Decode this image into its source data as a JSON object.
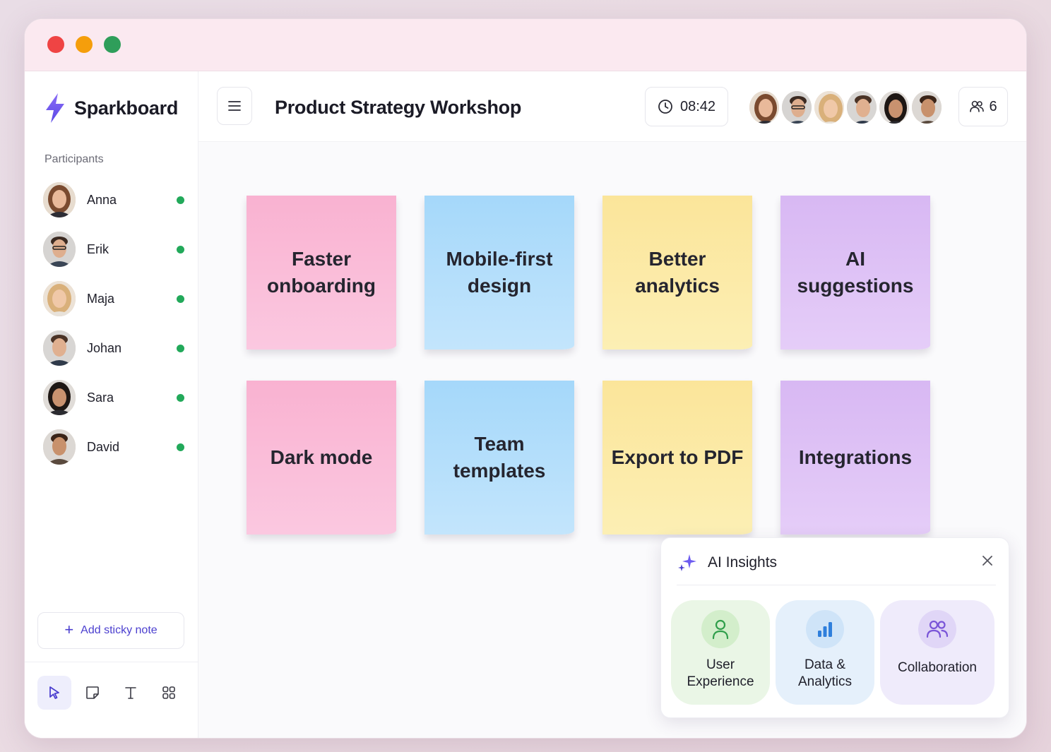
{
  "brand": {
    "name": "Sparkboard"
  },
  "sidebar": {
    "participants_label": "Participants",
    "participants": [
      {
        "name": "Anna",
        "status": "online"
      },
      {
        "name": "Erik",
        "status": "online"
      },
      {
        "name": "Maja",
        "status": "online"
      },
      {
        "name": "Johan",
        "status": "online"
      },
      {
        "name": "Sara",
        "status": "online"
      },
      {
        "name": "David",
        "status": "online"
      }
    ],
    "add_note_label": "Add sticky note",
    "tools": [
      "cursor-icon",
      "sticky-note-icon",
      "text-icon",
      "grid-icon"
    ]
  },
  "header": {
    "title": "Product Strategy Workshop",
    "timer": "08:42",
    "participant_count": "6"
  },
  "notes": [
    {
      "text": "Faster onboarding",
      "color": "pink"
    },
    {
      "text": "Mobile-first design",
      "color": "blue"
    },
    {
      "text": "Better analytics",
      "color": "yellow"
    },
    {
      "text": "AI suggestions",
      "color": "purple"
    },
    {
      "text": "Dark mode",
      "color": "pink"
    },
    {
      "text": "Team templates",
      "color": "blue"
    },
    {
      "text": "Export to PDF",
      "color": "yellow"
    },
    {
      "text": "Integrations",
      "color": "purple"
    }
  ],
  "insights": {
    "title": "AI Insights",
    "cards": [
      {
        "line1": "User",
        "line2": "Experience",
        "icon": "user-icon"
      },
      {
        "line1": "Data &",
        "line2": "Analytics",
        "icon": "bar-chart-icon"
      },
      {
        "line1": "Collaboration",
        "line2": "",
        "icon": "users-icon"
      }
    ]
  },
  "colors": {
    "accent": "#4b3fcf",
    "online": "#22a95a",
    "brand_bolt": "#6d5cf0"
  }
}
